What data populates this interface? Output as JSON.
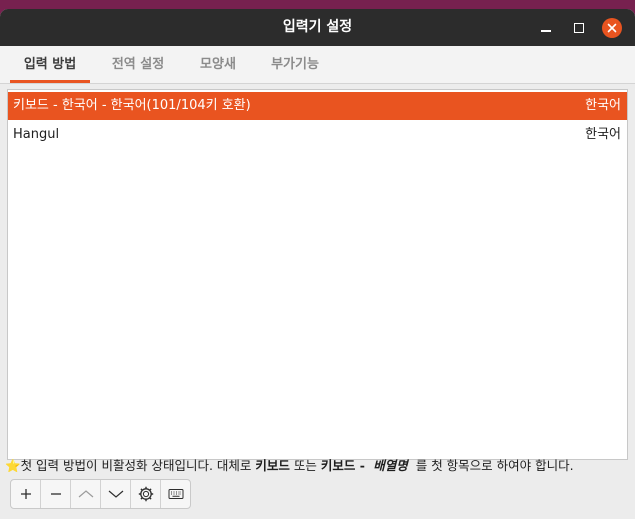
{
  "window": {
    "title": "입력기 설정"
  },
  "tabs": [
    {
      "label": "입력 방법",
      "active": true
    },
    {
      "label": "전역 설정",
      "active": false
    },
    {
      "label": "모양새",
      "active": false
    },
    {
      "label": "부가기능",
      "active": false
    }
  ],
  "input_methods": [
    {
      "name": "키보드 - 한국어 - 한국어(101/104키 호환)",
      "language": "한국어",
      "selected": true
    },
    {
      "name": "Hangul",
      "language": "한국어",
      "selected": false
    }
  ],
  "hint": {
    "star": "⭐",
    "part1": "첫 입력 방법이 비활성화 상태입니다. 대체로 ",
    "bold1": "키보드",
    "part2": " 또는 ",
    "bold2": "키보드 - ",
    "italic": "배열명",
    "part3": " 를 첫 항목으로 하여야 합니다."
  },
  "toolbar": {
    "buttons": [
      "add-icon",
      "remove-icon",
      "move-up-icon",
      "move-down-icon",
      "configure-icon",
      "keyboard-layout-icon"
    ]
  },
  "colors": {
    "accent": "#e95420",
    "titlebar": "#2c2c2c"
  }
}
